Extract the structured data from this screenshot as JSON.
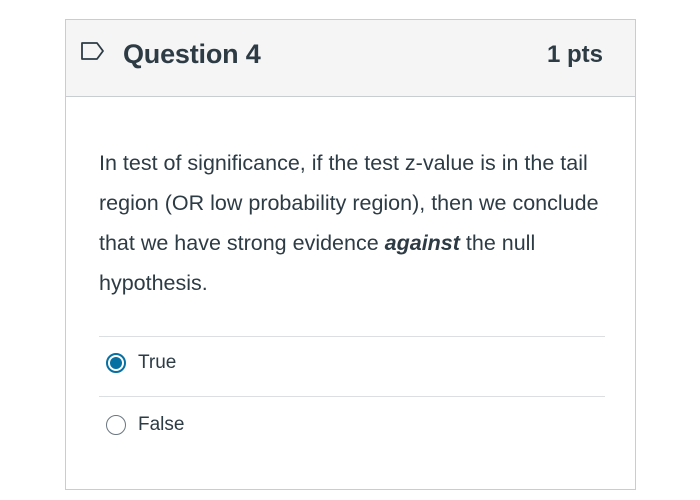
{
  "question": {
    "title": "Question 4",
    "points": "1 pts",
    "text_before": "In test of significance, if the test z-value is in the tail region (OR low probability region), then we conclude that we have strong evidence ",
    "text_emphasis": "against",
    "text_after": " the null hypothesis."
  },
  "answers": [
    {
      "label": "True",
      "selected": true
    },
    {
      "label": "False",
      "selected": false
    }
  ],
  "icons": {
    "flag": "flag-outline-icon"
  },
  "colors": {
    "accent": "#0770a3",
    "text": "#2d3b45",
    "header_bg": "#f5f5f5"
  }
}
